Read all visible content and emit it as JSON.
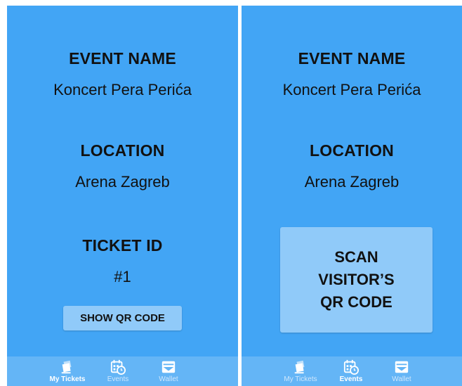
{
  "left_screen": {
    "event_label": "EVENT NAME",
    "event_value": "Koncert Pera Perića",
    "location_label": "LOCATION",
    "location_value": "Arena Zagreb",
    "ticket_label": "TICKET ID",
    "ticket_value": "#1",
    "show_qr_label": "SHOW QR CODE",
    "active_tab": "My Tickets"
  },
  "right_screen": {
    "event_label": "EVENT NAME",
    "event_value": "Koncert Pera Perića",
    "location_label": "LOCATION",
    "location_value": "Arena Zagreb",
    "scan_lines": [
      "SCAN",
      "VISITOR’S",
      "QR CODE"
    ],
    "active_tab": "Events"
  },
  "nav": {
    "items": [
      {
        "label": "My Tickets",
        "icon": "tickets-icon"
      },
      {
        "label": "Events",
        "icon": "calendar-clock-icon"
      },
      {
        "label": "Wallet",
        "icon": "wallet-icon"
      }
    ]
  },
  "colors": {
    "screen_bg": "#42a5f5",
    "button_bg": "#90caf9",
    "nav_bg": "#64b5f6",
    "text": "#111111",
    "nav_inactive": "#cfe6fb",
    "nav_active": "#ffffff"
  }
}
